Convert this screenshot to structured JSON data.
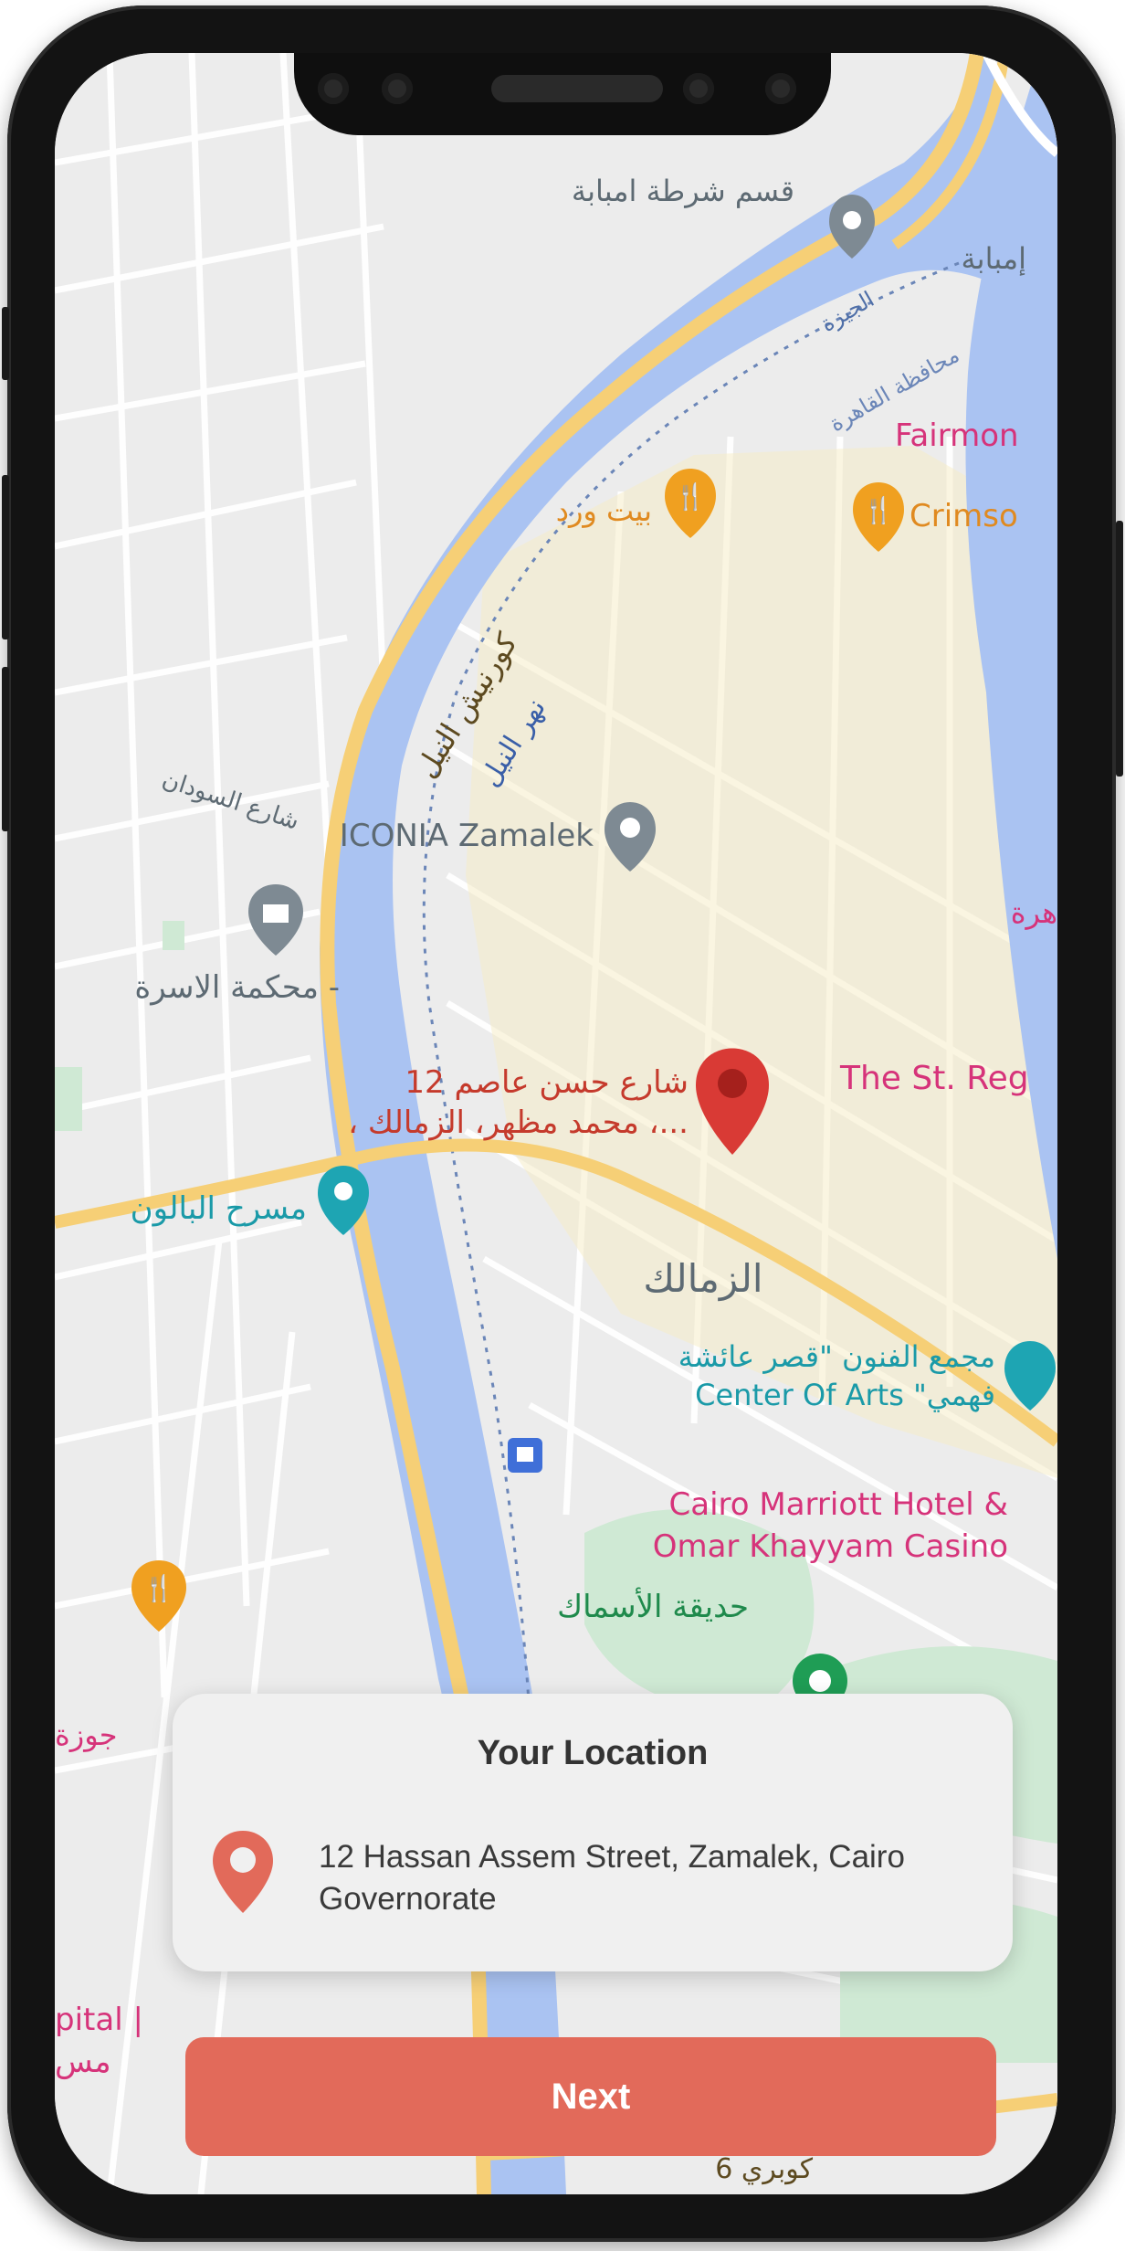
{
  "map": {
    "pin_label_line1": "12 شارع حسن عاصم",
    "pin_label_line2": "، محمد مظهر، الزمالك ،...",
    "labels": {
      "imbaba_police": "قسم شرطة امبابة",
      "imbaba": "إمبابة",
      "giza": "الجيزة",
      "cairo_gov": "محافظة القاهرة",
      "fairmont": "Fairmon",
      "beit_ward": "بيت ورد",
      "crimson": "Crimso",
      "nile_corniche": "كورنيش النيل",
      "nile_river": "نهر النيل",
      "iconia": "ICONIA Zamalek",
      "family_court": "محكمة الاسرة -",
      "st_regis": "The St. Reg",
      "balloon_theater": "مسرح البالون",
      "zamalek": "الزمالك",
      "aisha_line1": "مجمع الفنون \"قصر عائشة",
      "aisha_line2": "Center Of Arts \"فهمي",
      "marriott_line1": "Cairo Marriott Hotel &",
      "marriott_line2": "Omar Khayyam Casino",
      "fish_garden": "حديقة الأسماك",
      "sudan_st": "شارع السودان",
      "agouza": "جوزة",
      "hospital_partial": "pital |",
      "hospital_ar": "مس",
      "cairo_right": "هرة",
      "kobri": "كوبري 6"
    },
    "colors": {
      "river": "#aac3f2",
      "corniche": "#f6cf76",
      "zamalek_area": "#f6ecc8",
      "pin": "#d93a35",
      "poi_food": "#f0a020",
      "poi_gray": "#7e8a93",
      "poi_teal": "#1ea5b3",
      "park": "#cfe9d4"
    }
  },
  "location_card": {
    "title": "Your Location",
    "address": "12 Hassan Assem Street, Zamalek, Cairo Governorate",
    "icon": "map-pin-icon"
  },
  "next_button": {
    "label": "Next",
    "color": "#e26a5a"
  }
}
